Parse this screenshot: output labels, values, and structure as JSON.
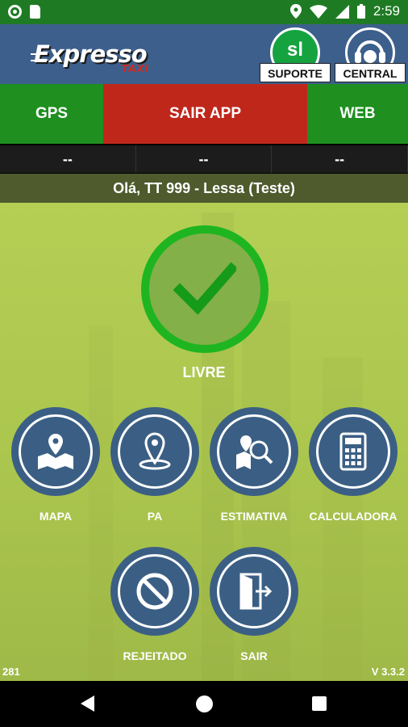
{
  "status_bar": {
    "time": "2:59"
  },
  "header": {
    "logo_main": "Expresso",
    "logo_sub": "TAXI",
    "suporte_icon_text": "sl",
    "suporte_label": "SUPORTE",
    "central_label": "CENTRAL"
  },
  "actions": {
    "gps": "GPS",
    "sair_app": "SAIR APP",
    "web": "WEB"
  },
  "info_row": [
    "--",
    "--",
    "--"
  ],
  "greeting": "Olá, TT 999 - Lessa (Teste)",
  "status": {
    "label": "LIVRE"
  },
  "tiles": [
    {
      "label": "MAPA",
      "icon": "map-icon"
    },
    {
      "label": "PA",
      "icon": "location-pin-icon"
    },
    {
      "label": "ESTIMATIVA",
      "icon": "map-search-icon"
    },
    {
      "label": "CALCULADORA",
      "icon": "calculator-icon"
    },
    {
      "label": "REJEITADO",
      "icon": "prohibited-icon"
    },
    {
      "label": "SAIR",
      "icon": "exit-door-icon"
    }
  ],
  "footer": {
    "code": "281",
    "version": "V 3.3.2"
  },
  "colors": {
    "status_bar": "#1e7b23",
    "header": "#3c5f8c",
    "gps": "#1f8f1f",
    "sair_app": "#c0271b",
    "tile": "#3b5f84",
    "free_status": "#1eb521",
    "background": "#b5cf55"
  }
}
